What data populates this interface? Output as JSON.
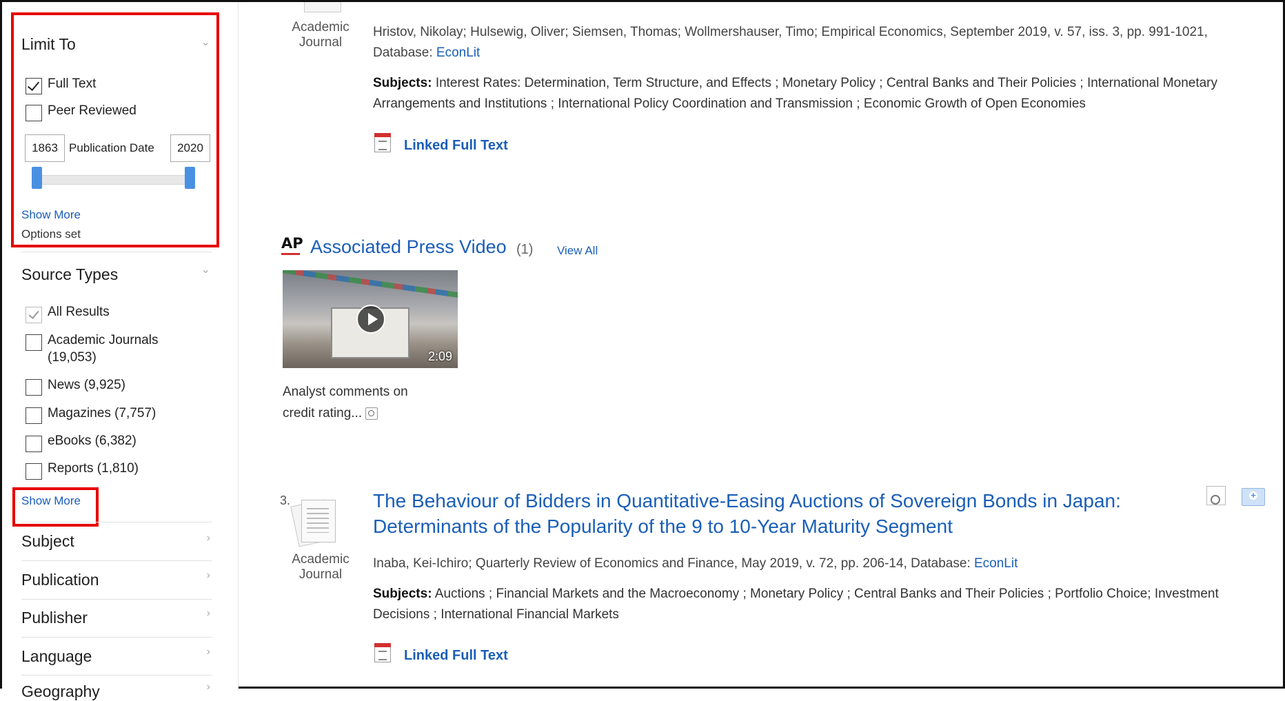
{
  "sidebar": {
    "limit_to": {
      "heading": "Limit To",
      "full_text": "Full Text",
      "peer_reviewed": "Peer Reviewed",
      "date_from": "1863",
      "date_label": "Publication Date",
      "date_to": "2020",
      "show_more": "Show More",
      "options_set": "Options set"
    },
    "source_types": {
      "heading": "Source Types",
      "items": [
        {
          "label": "All Results"
        },
        {
          "label": "Academic Journals",
          "count": "(19,053)"
        },
        {
          "label": "News (9,925)"
        },
        {
          "label": "Magazines (7,757)"
        },
        {
          "label": "eBooks (6,382)"
        },
        {
          "label": "Reports (1,810)"
        }
      ],
      "show_more": "Show More"
    },
    "facets": [
      "Subject",
      "Publication",
      "Publisher",
      "Language",
      "Geography"
    ]
  },
  "results": {
    "result2": {
      "doc_type": [
        "Academic",
        "Journal"
      ],
      "meta_line1": "Hristov, Nikolay; Hulsewig, Oliver; Siemsen, Thomas; Wollmershauser, Timo; Empirical Economics, September 2019, v. 57, iss. 3, pp. 991-1021,",
      "meta_db_label": "Database: ",
      "meta_db_link": "EconLit",
      "subjects_label": "Subjects:",
      "subjects": "Interest Rates: Determination, Term Structure, and Effects ; Monetary Policy ; Central Banks and Their Policies ; International Monetary Arrangements and Institutions ; International Policy Coordination and Transmission ; Economic Growth of Open Economies",
      "linked": "Linked Full Text"
    },
    "ap_video": {
      "logo": "AP",
      "title": "Associated Press Video",
      "count": "(1)",
      "view_all": "View All",
      "duration": "2:09",
      "caption_line1": "Analyst comments on",
      "caption_line2": "credit rating..."
    },
    "result3": {
      "number": "3.",
      "doc_type": [
        "Academic",
        "Journal"
      ],
      "title": "The Behaviour of Bidders in Quantitative-Easing Auctions of Sovereign Bonds in Japan: Determinants of the Popularity of the 9 to 10-Year Maturity Segment",
      "meta": "Inaba, Kei-Ichiro; Quarterly Review of Economics and Finance, May 2019, v. 72, pp. 206-14, Database: ",
      "meta_db_link": "EconLit",
      "subjects_label": "Subjects:",
      "subjects": "Auctions ; Financial Markets and the Macroeconomy ; Monetary Policy ; Central Banks and Their Policies ; Portfolio Choice; Investment Decisions ; International Financial Markets",
      "linked": "Linked Full Text"
    }
  }
}
